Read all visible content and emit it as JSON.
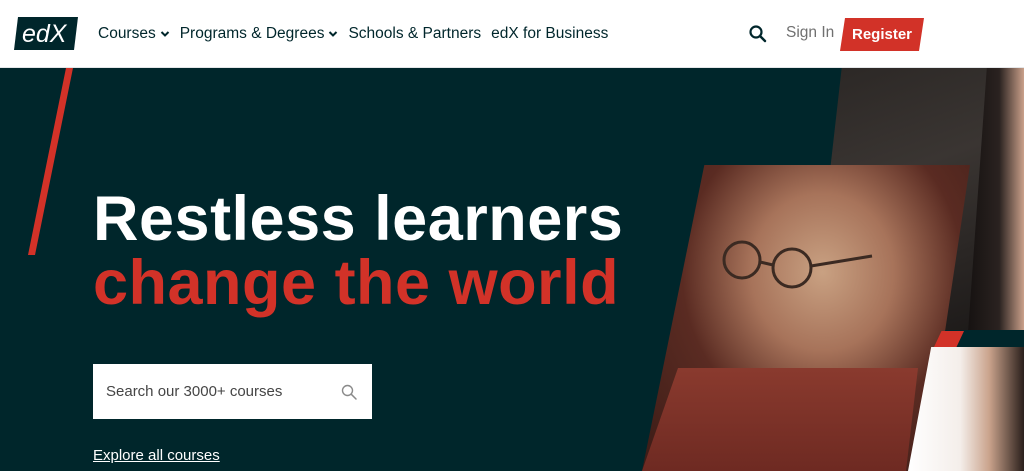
{
  "logo": {
    "text": "edX"
  },
  "nav": {
    "items": [
      {
        "label": "Courses",
        "has_dropdown": true
      },
      {
        "label": "Programs & Degrees",
        "has_dropdown": true
      },
      {
        "label": "Schools & Partners",
        "has_dropdown": false
      },
      {
        "label": "edX for Business",
        "has_dropdown": false
      }
    ],
    "search_icon": "search-icon",
    "sign_in": "Sign In",
    "register": "Register"
  },
  "hero": {
    "headline_line1": "Restless learners",
    "headline_line2": "change the world",
    "search_placeholder": "Search our 3000+ courses",
    "explore_link": "Explore all courses"
  },
  "colors": {
    "brand_red": "#d23228",
    "hero_bg": "#00262b",
    "nav_text": "#00262b",
    "muted_text": "#707070"
  }
}
